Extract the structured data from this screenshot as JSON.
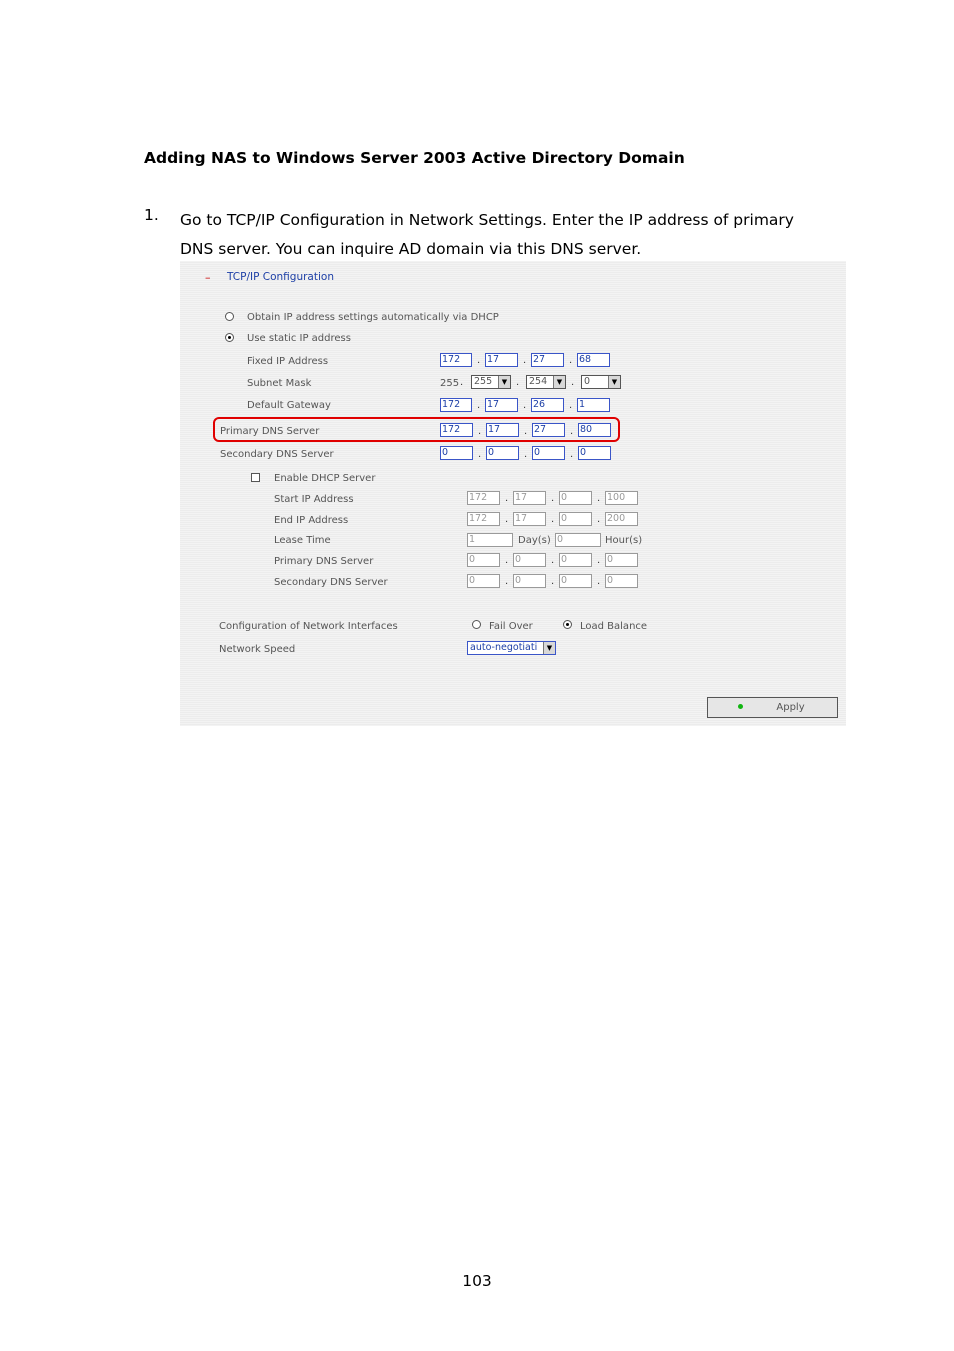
{
  "heading": "Adding NAS to Windows Server 2003 Active Directory Domain",
  "step": {
    "number": "1.",
    "text": "Go to TCP/IP Configuration in Network Settings.  Enter the IP address of primary DNS server.  You can inquire AD domain via this DNS server."
  },
  "panel": {
    "collapse_symbol": "–",
    "title": "TCP/IP Configuration",
    "opt_dhcp": "Obtain IP address settings automatically via DHCP",
    "opt_static": "Use static IP address",
    "fixed_ip_label": "Fixed IP Address",
    "fixed_ip": [
      "172",
      "17",
      "27",
      "68"
    ],
    "subnet_label": "Subnet Mask",
    "subnet_first": "255",
    "subnet": [
      "255",
      "254",
      "0"
    ],
    "gateway_label": "Default Gateway",
    "gateway": [
      "172",
      "17",
      "26",
      "1"
    ],
    "pdns_label": "Primary DNS Server",
    "pdns": [
      "172",
      "17",
      "27",
      "80"
    ],
    "sdns_label": "Secondary DNS Server",
    "sdns": [
      "0",
      "0",
      "0",
      "0"
    ],
    "dhcp_server": {
      "enable_label": "Enable DHCP Server",
      "start_label": "Start IP Address",
      "start": [
        "172",
        "17",
        "0",
        "100"
      ],
      "end_label": "End IP Address",
      "end": [
        "172",
        "17",
        "0",
        "200"
      ],
      "lease_label": "Lease Time",
      "lease_days": "1",
      "days_unit": "Day(s)",
      "lease_hours": "0",
      "hours_unit": "Hour(s)",
      "pdns_label": "Primary DNS Server",
      "pdns": [
        "0",
        "0",
        "0",
        "0"
      ],
      "sdns_label": "Secondary DNS Server",
      "sdns": [
        "0",
        "0",
        "0",
        "0"
      ]
    },
    "config_label": "Configuration of Network Interfaces",
    "fail_over": "Fail Over",
    "load_balance": "Load Balance",
    "speed_label": "Network Speed",
    "speed_value": "auto-negotiati",
    "apply_label": "Apply",
    "highlight_color": "#e00000",
    "apply_led_color": "#11b511"
  },
  "page_number": "103"
}
